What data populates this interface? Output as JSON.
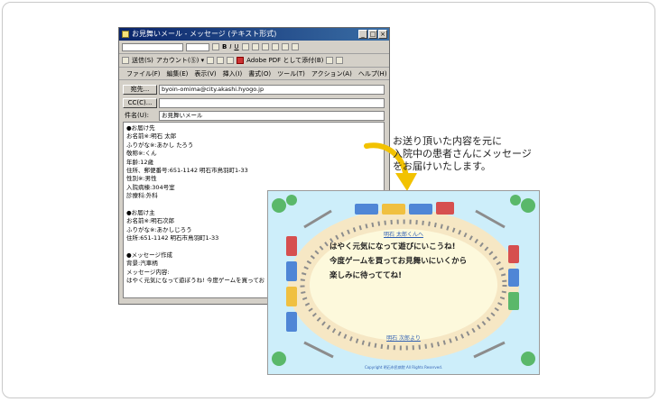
{
  "window": {
    "title": "お見舞いメール - メッセージ (テキスト形式)",
    "controls": [
      "_",
      "□",
      "×"
    ]
  },
  "toolbar": {
    "send_label": "送信(S)",
    "account_label": "アカウント(Ⓢ) ▾",
    "pdf_label": "Adobe PDF として添付(B)",
    "format_icons": [
      "B",
      "I",
      "U"
    ]
  },
  "menu": [
    "ファイル(F)",
    "編集(E)",
    "表示(V)",
    "挿入(I)",
    "書式(O)",
    "ツール(T)",
    "アクション(A)",
    "ヘルプ(H)"
  ],
  "header": {
    "to_label": "宛先...",
    "to_value": "byoin-omima@city.akashi.hyogo.jp",
    "cc_label": "CC(C)...",
    "cc_value": "",
    "subject_label": "件名(U):",
    "subject_value": "お見舞いメール"
  },
  "body_lines": [
    "●お届け先",
    "お名前※:明石 太郎",
    "ふりがな※:あかし たろう",
    "敬称※:くん",
    "年齢:12歳",
    "住所、郵便番号:651-1142 明石市鳥羽町1-33",
    "性別※:男性",
    "入院病棟:304号室",
    "診療科:外科",
    "",
    "●お届け主",
    "お名前※:明石次郎",
    "ふりがな※:あかしじろう",
    "住所:651-1142 明石市鳥羽町1-33",
    "",
    "●メッセージ作成",
    "背景:汽車柄",
    "メッセージ内容:",
    "はやく元気になって遊ぼうね! 今度ゲームを買ってお"
  ],
  "callout": {
    "lines": [
      "お送り頂いた内容を元に",
      "入院中の患者さんにメッセージ",
      "をお届けいたします。"
    ]
  },
  "card": {
    "to_line": "明石 太郎くんへ",
    "message_lines": [
      "はやく元気になって遊びにいこうね!",
      "今度ゲームを買ってお見舞いにいくから",
      "楽しみに待っててね!"
    ],
    "from_line": "明石 次郎より",
    "copyright": "Copyright 明石市民病院 All Rights Reserved."
  },
  "colors": {
    "card_sky": "#cdeefa",
    "card_center": "#fdf9dc",
    "track": "#8c8c8c",
    "arrow": "#f2c200",
    "title_bar": "#0a246a",
    "text_blue": "#2f5fb3"
  }
}
